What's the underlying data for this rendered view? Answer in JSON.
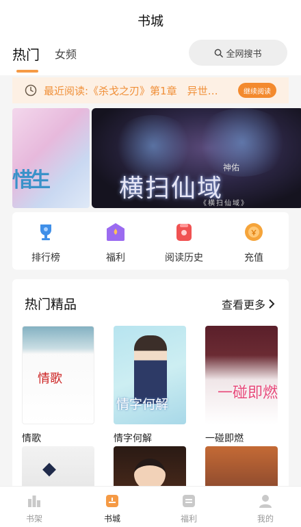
{
  "header": {
    "title": "书城"
  },
  "tabs": {
    "active": "热门",
    "inactive": "女频"
  },
  "search": {
    "label": "全网搜书"
  },
  "recent": {
    "text": "最近阅读:《杀戈之刃》第1章　异世…",
    "button": "继续阅读"
  },
  "banner": {
    "left_glyph": "惜生",
    "title": "横扫仙域",
    "author": "神佑",
    "subtitle": "《横扫仙域》"
  },
  "quick": [
    {
      "label": "排行榜",
      "icon": "trophy-icon",
      "color": "#3f8fe8"
    },
    {
      "label": "福利",
      "icon": "gift-house-icon",
      "color": "#9b6bf0"
    },
    {
      "label": "阅读历史",
      "icon": "history-icon",
      "color": "#f05252"
    },
    {
      "label": "充值",
      "icon": "coin-icon",
      "color": "#f5a43a"
    }
  ],
  "hot": {
    "title": "热门精品",
    "more": "查看更多",
    "books": [
      {
        "name": "情歌",
        "cover_text": "情歌"
      },
      {
        "name": "情字何解",
        "cover_text": "情字何解"
      },
      {
        "name": "一碰即燃",
        "cover_text": "一碰即燃"
      }
    ]
  },
  "nav": [
    {
      "label": "书架",
      "icon": "bookshelf-icon"
    },
    {
      "label": "书城",
      "icon": "bookstore-icon",
      "active": true
    },
    {
      "label": "福利",
      "icon": "welfare-icon"
    },
    {
      "label": "我的",
      "icon": "profile-icon"
    }
  ],
  "colors": {
    "accent": "#f38a2e",
    "recent_bg": "#fdf0e4"
  }
}
